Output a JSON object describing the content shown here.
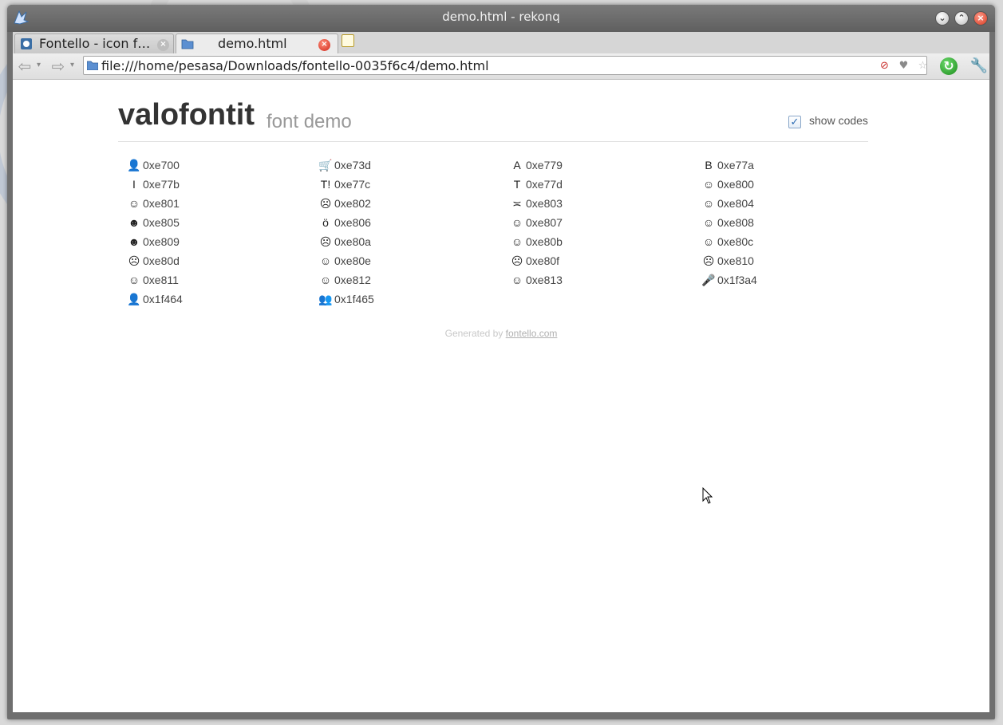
{
  "window": {
    "title": "demo.html - rekonq"
  },
  "tabs": [
    {
      "label": "Fontello - icon f…",
      "active": false
    },
    {
      "label": "demo.html",
      "active": true
    }
  ],
  "navbar": {
    "url": "file:///home/pesasa/Downloads/fontello-0035f6c4/demo.html"
  },
  "header": {
    "title": "valofontit",
    "subtitle": "font demo",
    "show_codes_label": "show codes",
    "show_codes_checked": true
  },
  "glyphs": [
    {
      "icon": "user-add-icon",
      "glyph": "👤",
      "code": "0xe700"
    },
    {
      "icon": "cart-icon",
      "glyph": "🛒",
      "code": "0xe73d"
    },
    {
      "icon": "font-icon",
      "glyph": "A",
      "code": "0xe779"
    },
    {
      "icon": "bold-icon",
      "glyph": "B",
      "code": "0xe77a"
    },
    {
      "icon": "italic-icon",
      "glyph": "I",
      "code": "0xe77b"
    },
    {
      "icon": "text-height-icon",
      "glyph": "T!",
      "code": "0xe77c"
    },
    {
      "icon": "text-width-icon",
      "glyph": "T",
      "code": "0xe77d"
    },
    {
      "icon": "emo-happy-icon",
      "glyph": "☺",
      "code": "0xe800"
    },
    {
      "icon": "emo-wink-icon",
      "glyph": "☺",
      "code": "0xe801"
    },
    {
      "icon": "emo-unhappy-icon",
      "glyph": "☹",
      "code": "0xe802"
    },
    {
      "icon": "emo-sleep-icon",
      "glyph": "≍",
      "code": "0xe803"
    },
    {
      "icon": "emo-thumbsup-icon",
      "glyph": "☺",
      "code": "0xe804"
    },
    {
      "icon": "emo-devil-icon",
      "glyph": "☻",
      "code": "0xe805"
    },
    {
      "icon": "emo-surprised-icon",
      "glyph": "ö",
      "code": "0xe806"
    },
    {
      "icon": "emo-tongue-icon",
      "glyph": "☺",
      "code": "0xe807"
    },
    {
      "icon": "emo-coffee-icon",
      "glyph": "☺",
      "code": "0xe808"
    },
    {
      "icon": "emo-sunglasses-icon",
      "glyph": "☻",
      "code": "0xe809"
    },
    {
      "icon": "emo-displeased-icon",
      "glyph": "☹",
      "code": "0xe80a"
    },
    {
      "icon": "emo-beer-icon",
      "glyph": "☺",
      "code": "0xe80b"
    },
    {
      "icon": "emo-grin-icon",
      "glyph": "☺",
      "code": "0xe80c"
    },
    {
      "icon": "emo-angry-icon",
      "glyph": "☹",
      "code": "0xe80d"
    },
    {
      "icon": "emo-saint-icon",
      "glyph": "☺",
      "code": "0xe80e"
    },
    {
      "icon": "emo-cry-icon",
      "glyph": "☹",
      "code": "0xe80f"
    },
    {
      "icon": "emo-shoot-icon",
      "glyph": "☹",
      "code": "0xe810"
    },
    {
      "icon": "emo-squint-icon",
      "glyph": "☺",
      "code": "0xe811"
    },
    {
      "icon": "emo-laugh-icon",
      "glyph": "☺",
      "code": "0xe812"
    },
    {
      "icon": "emo-wink2-icon",
      "glyph": "☺",
      "code": "0xe813"
    },
    {
      "icon": "mic-icon",
      "glyph": "🎤",
      "code": "0x1f3a4"
    },
    {
      "icon": "user-icon",
      "glyph": "👤",
      "code": "0x1f464"
    },
    {
      "icon": "users-icon",
      "glyph": "👥",
      "code": "0x1f465"
    }
  ],
  "footer": {
    "prefix": "Generated by ",
    "link": "fontello.com"
  }
}
